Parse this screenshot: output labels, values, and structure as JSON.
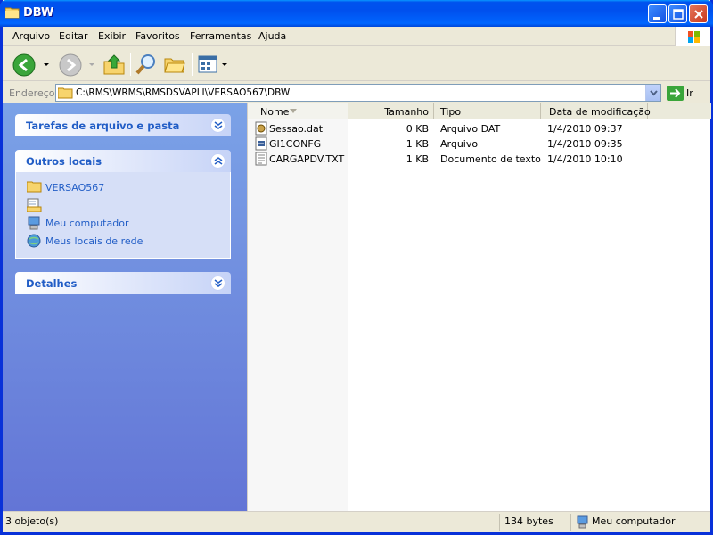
{
  "window": {
    "title": "DBW"
  },
  "menu": {
    "items": [
      "Arquivo",
      "Editar",
      "Exibir",
      "Favoritos",
      "Ferramentas",
      "Ajuda"
    ]
  },
  "address": {
    "label": "Endereço",
    "path": "C:\\RMS\\WRMS\\RMSDSVAPLI\\VERSAO567\\DBW",
    "go_label": "Ir"
  },
  "taskpane": {
    "file_tasks": {
      "title": "Tarefas de arquivo e pasta"
    },
    "other_places": {
      "title": "Outros locais",
      "links": [
        "VERSAO567",
        "",
        "Meu computador",
        "Meus locais de rede"
      ]
    },
    "details": {
      "title": "Detalhes"
    }
  },
  "filelist": {
    "columns": [
      "Nome",
      "Tamanho",
      "Tipo",
      "Data de modificação"
    ],
    "rows": [
      {
        "name": "Sessao.dat",
        "size": "0 KB",
        "type": "Arquivo DAT",
        "modified": "1/4/2010 09:37",
        "icon": "dat-file-icon"
      },
      {
        "name": "GI1CONFG",
        "size": "1 KB",
        "type": "Arquivo",
        "modified": "1/4/2010 09:35",
        "icon": "config-file-icon"
      },
      {
        "name": "CARGAPDV.TXT",
        "size": "1 KB",
        "type": "Documento de texto",
        "modified": "1/4/2010 10:10",
        "icon": "text-file-icon"
      }
    ]
  },
  "status": {
    "count": "3 objeto(s)",
    "size": "134 bytes",
    "location": "Meu computador"
  },
  "colors": {
    "title_blue": "#0055ea",
    "pane_top": "#7ba2e7",
    "pane_bottom": "#6375d6",
    "link_blue": "#215dc6"
  }
}
